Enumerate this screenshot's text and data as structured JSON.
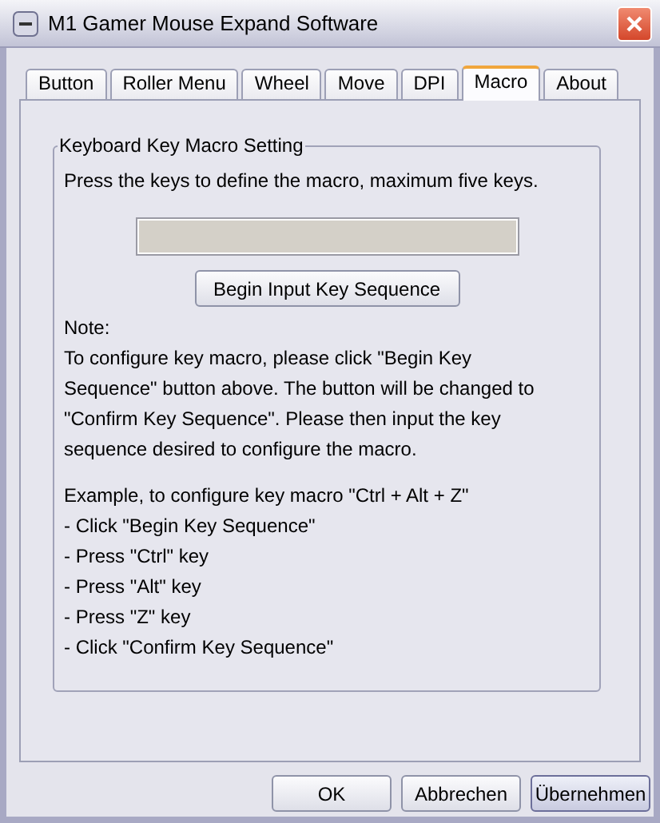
{
  "window": {
    "title": "M1 Gamer Mouse Expand Software"
  },
  "tabs": [
    {
      "label": "Button",
      "selected": false
    },
    {
      "label": "Roller Menu",
      "selected": false
    },
    {
      "label": "Wheel",
      "selected": false
    },
    {
      "label": "Move",
      "selected": false
    },
    {
      "label": "DPI",
      "selected": false
    },
    {
      "label": "Macro",
      "selected": true
    },
    {
      "label": "About",
      "selected": false
    }
  ],
  "group": {
    "title": "Keyboard Key Macro Setting",
    "instruction": "Press the keys to define the macro, maximum five keys.",
    "key_field": {
      "disabled": true
    },
    "begin_button": "Begin Input Key Sequence",
    "note_heading": "Note:",
    "note": "To configure key macro, please click \"Begin Key Sequence\" button above. The button will be changed to \"Confirm Key Sequence\". Please then input the key sequence desired to configure the macro.",
    "example_heading": "Example, to configure key macro \"Ctrl + Alt + Z\"",
    "steps": [
      "- Click \"Begin Key Sequence\"",
      "- Press \"Ctrl\" key",
      "- Press \"Alt\" key",
      "- Press \"Z\" key",
      "- Click \"Confirm Key Sequence\""
    ]
  },
  "buttons": [
    {
      "label": "OK",
      "selected": false
    },
    {
      "label": "Abbrechen",
      "selected": false
    },
    {
      "label": "Übernehmen",
      "selected": true
    }
  ]
}
